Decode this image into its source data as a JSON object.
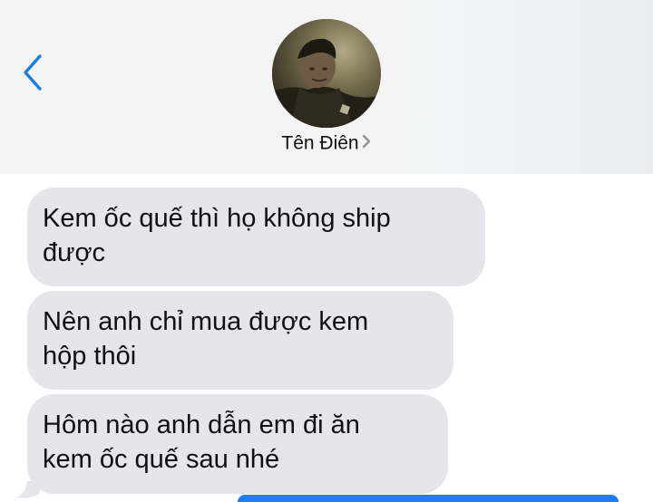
{
  "header": {
    "contact_name": "Tên Điên",
    "icons": {
      "back": "chevron-left-icon",
      "details": "chevron-right-icon"
    },
    "accent_color": "#1a7bea"
  },
  "messages": [
    {
      "text_line1": "Kem ốc quế thì họ không ship",
      "text_line2": "được"
    },
    {
      "text_line1": "Nên anh chỉ mua được kem",
      "text_line2": "hộp thôi"
    },
    {
      "text_line1": "Hôm nào anh dẫn em đi ăn",
      "text_line2": "kem ốc quế sau nhé"
    }
  ],
  "colors": {
    "incoming_bubble": "#e5e5ea",
    "outgoing_bubble": "#1f7ef5"
  }
}
